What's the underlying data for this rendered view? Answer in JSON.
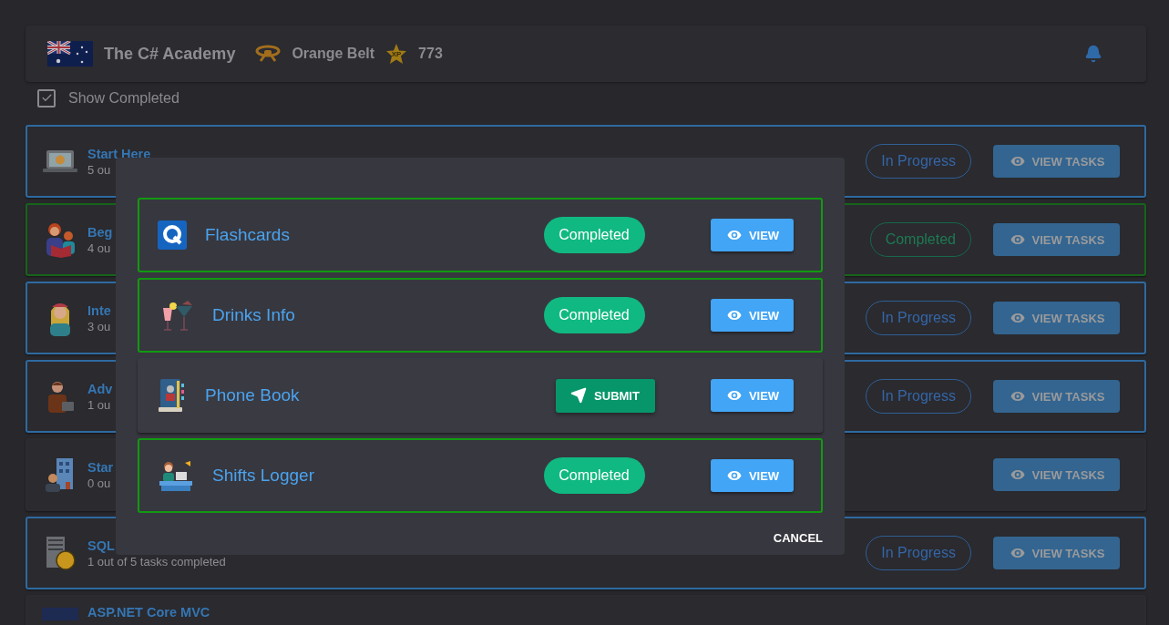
{
  "header": {
    "title": "The C# Academy",
    "belt": "Orange Belt",
    "xp_badge": "XP",
    "xp": "773"
  },
  "show_completed": {
    "label": "Show Completed",
    "checked": true
  },
  "courses": [
    {
      "title": "Start Here",
      "subtitle": "5 ou",
      "kind": "progress",
      "status_label": "In Progress",
      "button": "VIEW TASKS"
    },
    {
      "title": "Beg",
      "subtitle": "4 ou",
      "kind": "completed",
      "status_label": "Completed",
      "button": "VIEW TASKS"
    },
    {
      "title": "Inte",
      "subtitle": "3 ou",
      "kind": "progress",
      "status_label": "In Progress",
      "button": "VIEW TASKS"
    },
    {
      "title": "Adv",
      "subtitle": "1 ou",
      "kind": "progress",
      "status_label": "In Progress",
      "button": "VIEW TASKS"
    },
    {
      "title": "Star",
      "subtitle": "0 ou",
      "kind": "plain",
      "button": "VIEW TASKS"
    },
    {
      "title": "SQL",
      "subtitle": "1 out of 5 tasks completed",
      "kind": "progress",
      "status_label": "In Progress",
      "button": "VIEW TASKS"
    },
    {
      "title": "ASP.NET Core MVC",
      "kind": "plain"
    }
  ],
  "dialog": {
    "projects": [
      {
        "name": "Flashcards",
        "kind": "completed",
        "action": "Completed",
        "view": "VIEW"
      },
      {
        "name": "Drinks Info",
        "kind": "completed",
        "action": "Completed",
        "view": "VIEW"
      },
      {
        "name": "Phone Book",
        "kind": "submit",
        "action": "SUBMIT",
        "view": "VIEW"
      },
      {
        "name": "Shifts Logger",
        "kind": "completed",
        "action": "Completed",
        "view": "VIEW"
      }
    ],
    "cancel": "CANCEL"
  }
}
